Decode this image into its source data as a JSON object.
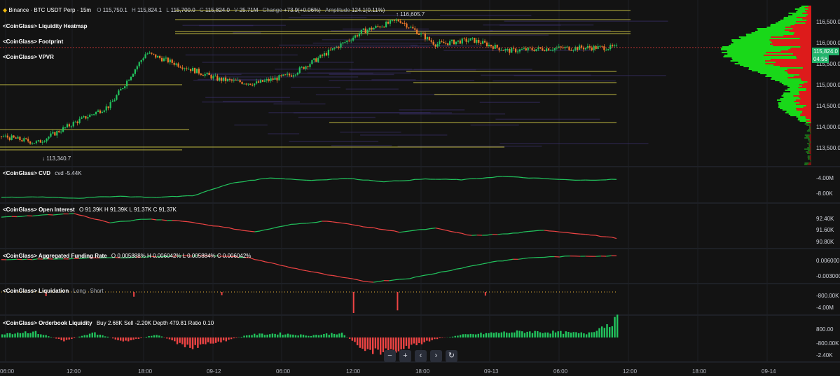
{
  "symbol": {
    "title": "Binance · BTC USDT Perp · 15m",
    "o_label": "O",
    "o": "115,750.1",
    "h_label": "H",
    "h": "115,824.1",
    "l_label": "L",
    "l": "115,700.0",
    "c_label": "C",
    "c": "115,824.0",
    "v_label": "V",
    "v": "25.71M",
    "change_label": "Change",
    "change": "+73.9(+0.06%)",
    "amp_label": "Amplitude",
    "amp": "124.1(0.11%)"
  },
  "overlays": [
    "<CoinGlass> Liquidity Heatmap",
    "<CoinGlass> Footprint",
    "<CoinGlass> VPVR"
  ],
  "annotations": {
    "high": "116,605.7",
    "low": "113,340.7"
  },
  "price_badges": {
    "last": "115,824.0",
    "countdown": "04:56"
  },
  "panes": {
    "cvd": {
      "name": "<CoinGlass> CVD",
      "val_label": "cvd",
      "val": "-5.44K"
    },
    "oi": {
      "name": "<CoinGlass> Open Interest",
      "o_label": "O",
      "o": "91.39K",
      "h_label": "H",
      "h": "91.39K",
      "l_label": "L",
      "l": "91.37K",
      "c_label": "C",
      "c": "91.37K"
    },
    "funding": {
      "name": "<CoinGlass> Aggregated Funding Rate",
      "o_label": "O",
      "o": "0.005888%",
      "h_label": "H",
      "h": "0.006042%",
      "l_label": "L",
      "l": "0.005884%",
      "c_label": "C",
      "c": "0.006042%"
    },
    "liq": {
      "name": "<CoinGlass> Liquidation",
      "long": "Long",
      "short": "Short"
    },
    "ob": {
      "name": "<CoinGlass> Orderbook Liquidity",
      "buy_label": "Buy",
      "buy": "2.68K",
      "sell_label": "Sell",
      "sell": "-2.20K",
      "depth_label": "Depth",
      "depth": "479.81",
      "ratio_label": "Ratio",
      "ratio": "0.10"
    }
  },
  "price_axis": [
    "116,500.0",
    "116,000.0",
    "115,500.0",
    "115,000.0",
    "114,500.0",
    "114,000.0",
    "113,500.0"
  ],
  "cvd_axis": [
    "-4.00M",
    "-8.00K"
  ],
  "oi_axis": [
    "92.40K",
    "91.60K",
    "90.80K"
  ],
  "funding_axis": [
    "0.006000",
    "-0.003000"
  ],
  "liq_axis": [
    "-800.00K",
    "-4.00M"
  ],
  "ob_axis": [
    "800.00",
    "-800.00K",
    "-2.40K"
  ],
  "time_axis": [
    "06:00",
    "12:00",
    "18:00",
    "09-12",
    "06:00",
    "12:00",
    "18:00",
    "09-13",
    "06:00",
    "12:00",
    "18:00",
    "09-14"
  ],
  "nav": [
    "−",
    "+",
    "‹",
    "›",
    "↻"
  ],
  "colors": {
    "up": "#22c55e",
    "down": "#ef4444",
    "bg": "#131313",
    "heat": "#e8e04a",
    "profile_green": "#19d819",
    "profile_red": "#dd1b1b",
    "last_price": "#23b36b"
  },
  "chart_data": [
    {
      "type": "line",
      "title": "Binance · BTC USDT Perp · 15m",
      "xlabel": "",
      "ylabel": "",
      "ylim": [
        113200,
        116750
      ],
      "x": [
        "06:00",
        "12:00",
        "18:00",
        "09-12",
        "06:00",
        "12:00",
        "18:00",
        "09-13",
        "06:00",
        "12:00"
      ],
      "series": [
        {
          "values": [
            113800,
            113650,
            114100,
            114500,
            115700,
            115400,
            115100,
            115000,
            115200,
            115700,
            116200,
            116450,
            115900,
            116000,
            115750,
            115800,
            115820,
            115824
          ]
        }
      ]
    },
    {
      "type": "line",
      "title": "<CoinGlass> CVD",
      "xlabel": "",
      "ylabel": "",
      "series": [
        {
          "values": [
            -8.2,
            -8.1,
            -8.3,
            -8.0,
            -8.2,
            -7.9,
            -6.0,
            -5.2,
            -5.6,
            -5.3,
            -5.8,
            -5.4,
            -5.5,
            -5.0,
            -5.3,
            -5.6,
            -5.44
          ]
        }
      ]
    },
    {
      "type": "line",
      "title": "<CoinGlass> Open Interest",
      "xlabel": "",
      "ylabel": "",
      "series": [
        {
          "values": [
            92.5,
            92.6,
            92.7,
            92.2,
            92.4,
            92.3,
            92.0,
            91.7,
            92.1,
            92.3,
            92.0,
            91.7,
            91.9,
            91.5,
            91.6,
            91.8,
            91.6,
            91.37
          ]
        }
      ]
    },
    {
      "type": "line",
      "title": "<CoinGlass> Aggregated Funding Rate",
      "xlabel": "",
      "ylabel": "",
      "series": [
        {
          "values": [
            0.0046,
            0.0049,
            0.0052,
            0.0055,
            0.0059,
            0.0062,
            0.0055,
            0.002,
            -0.001,
            -0.0035,
            -0.002,
            0.001,
            0.004,
            0.0055,
            0.006,
            0.006042
          ]
        }
      ]
    },
    {
      "type": "bar",
      "title": "<CoinGlass> Liquidation",
      "xlabel": "",
      "ylabel": "",
      "series": [
        {
          "values": [
            0,
            -800,
            0,
            -900,
            0,
            -600,
            0,
            0,
            -4000,
            -3500,
            0,
            -700,
            0,
            0,
            0
          ]
        }
      ]
    },
    {
      "type": "bar",
      "title": "<CoinGlass> Orderbook Liquidity",
      "xlabel": "",
      "ylabel": "",
      "series": [
        {
          "values": [
            600,
            900,
            -500,
            700,
            -700,
            500,
            -1500,
            -800,
            400,
            600,
            300,
            700,
            -2400,
            -1800,
            -300,
            400,
            700,
            900,
            800,
            600,
            2680
          ]
        }
      ]
    }
  ]
}
